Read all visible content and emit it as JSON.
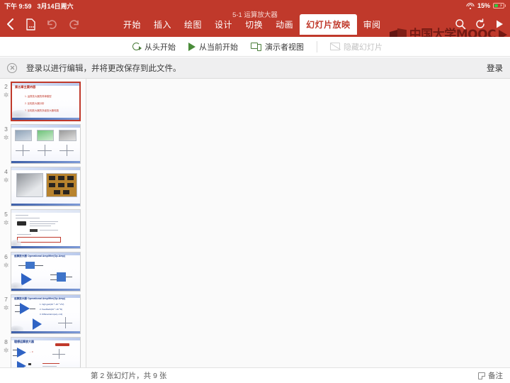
{
  "status_bar": {
    "time": "下午 9:59",
    "date": "3月14日周六",
    "wifi_icon": "wifi-icon",
    "battery_percent": "15%",
    "battery_icon": "battery-charging-icon"
  },
  "ribbon": {
    "document_title": "5-1 运算放大器",
    "back_icon": "back-chevron-icon",
    "file_icon": "file-options-icon",
    "undo_icon": "undo-icon",
    "redo_icon": "redo-icon",
    "search_icon": "search-icon",
    "sync_icon": "sync-icon",
    "play_icon": "play-icon",
    "tabs": [
      {
        "label": "开始",
        "active": false
      },
      {
        "label": "插入",
        "active": false
      },
      {
        "label": "绘图",
        "active": false
      },
      {
        "label": "设计",
        "active": false
      },
      {
        "label": "切换",
        "active": false
      },
      {
        "label": "动画",
        "active": false
      },
      {
        "label": "幻灯片放映",
        "active": true
      },
      {
        "label": "审阅",
        "active": false
      }
    ],
    "watermark": "中国大学MOOC"
  },
  "slideshow_toolbar": {
    "items": [
      {
        "label": "从头开始",
        "icon": "restart-presentation-icon",
        "disabled": false
      },
      {
        "label": "从当前开始",
        "icon": "play-from-current-icon",
        "disabled": false
      },
      {
        "label": "演示者视图",
        "icon": "presenter-view-icon",
        "disabled": false
      },
      {
        "label": "隐藏幻灯片",
        "icon": "hide-slide-icon",
        "disabled": true
      }
    ]
  },
  "notice": {
    "close_icon": "close-circle-icon",
    "message": "登录以进行编辑，并将更改保存到此文件。",
    "action_label": "登录"
  },
  "slide_panel": {
    "slides": [
      {
        "number": "2",
        "selected": true,
        "has_animation": true,
        "title": "第五章主要内容",
        "title_color": "#b02418",
        "bullets": [
          "1. 运算放大器的简单模型",
          "2. 反相放大器分析",
          "3. 反相放大器的多级放大器电路"
        ]
      },
      {
        "number": "3",
        "selected": false,
        "has_animation": true,
        "title": "",
        "kind": "three-photos-with-axes"
      },
      {
        "number": "4",
        "selected": false,
        "has_animation": true,
        "title": "",
        "kind": "two-chip-photos"
      },
      {
        "number": "5",
        "selected": false,
        "has_animation": true,
        "title": "",
        "kind": "datasheet-document"
      },
      {
        "number": "6",
        "selected": false,
        "has_animation": true,
        "title": "运算放大器  Operational Amplifier(Op-Amp)",
        "kind": "opamp-blocks"
      },
      {
        "number": "7",
        "selected": false,
        "has_animation": true,
        "title": "运算放大器  Operational Amplifier(Op-Amp)",
        "kind": "opamp-specs"
      },
      {
        "number": "8",
        "selected": false,
        "has_animation": true,
        "title": "理想运算放大器",
        "kind": "ideal-opamp"
      }
    ]
  },
  "bottom_bar": {
    "slide_status": "第 2 张幻灯片，共 9 张",
    "notes_label": "备注",
    "notes_icon": "notes-icon"
  },
  "colors": {
    "ribbon_red": "#c0392b",
    "active_tab_bg": "#ffffff",
    "notice_bg": "#efeff0",
    "stage_bg": "#fafafa",
    "accent_green": "#4a8c3a"
  }
}
